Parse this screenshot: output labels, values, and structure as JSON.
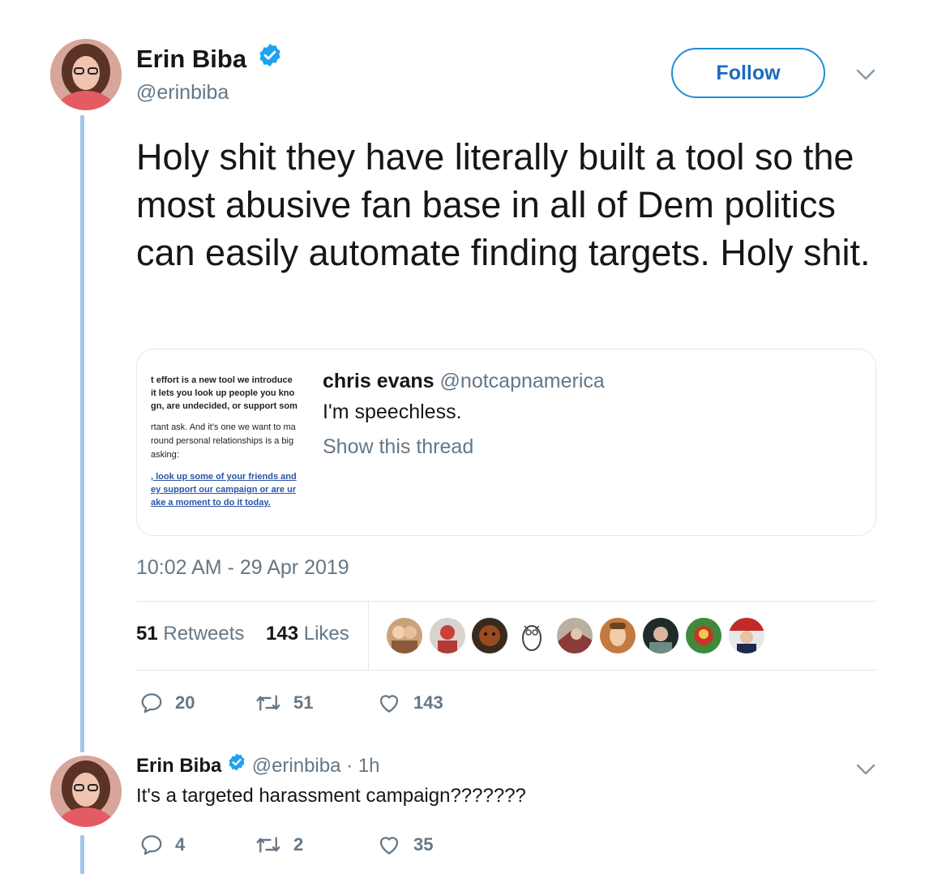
{
  "main_tweet": {
    "display_name": "Erin Biba",
    "handle": "@erinbiba",
    "follow_label": "Follow",
    "text": "Holy shit they have literally built a tool so the most abusive fan base in all of Dem politics can easily automate finding targets. Holy shit.",
    "timestamp": "10:02 AM - 29 Apr 2019",
    "retweets_count": "51",
    "retweets_label": "Retweets",
    "likes_count": "143",
    "likes_label": "Likes",
    "actions": {
      "replies": "20",
      "retweets": "51",
      "likes": "143"
    }
  },
  "quoted_tweet": {
    "display_name": "chris evans",
    "handle": "@notcapnamerica",
    "text": "I'm speechless.",
    "show_thread": "Show this thread",
    "thumbnail_lines": [
      "t effort is a new tool we introduce",
      "it lets you look up people you kno",
      "gn, are undecided, or support som",
      "rtant ask. And it's one we want to ma",
      "round personal relationships is a big",
      "asking:",
      ", look up some of your friends and",
      "ey support our campaign or are ur",
      "ake a moment to do it today."
    ]
  },
  "reply_tweet": {
    "display_name": "Erin Biba",
    "handle": "@erinbiba",
    "separator": "·",
    "time": "1h",
    "text": "It's a targeted harassment campaign???????",
    "actions": {
      "replies": "4",
      "retweets": "2",
      "likes": "35"
    }
  },
  "colors": {
    "accent": "#1da1f2",
    "follow_text": "#1b6bbf",
    "thread_line": "#a3c4ec",
    "secondary_text": "#657786"
  },
  "icons": [
    "verified-badge-icon",
    "chevron-down-icon",
    "reply-icon",
    "retweet-icon",
    "like-icon"
  ]
}
